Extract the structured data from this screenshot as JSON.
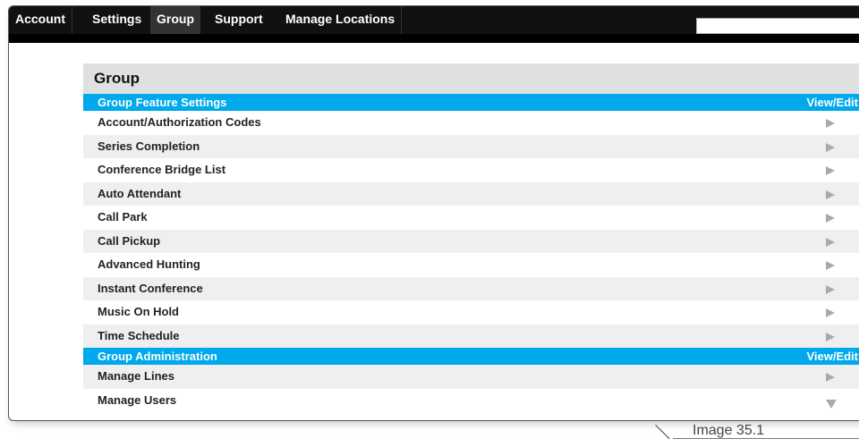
{
  "nav": {
    "items": [
      {
        "label": "Account"
      },
      {
        "label": "Settings"
      },
      {
        "label": "Group"
      },
      {
        "label": "Support"
      },
      {
        "label": "Manage Locations"
      }
    ],
    "active": "Group",
    "search_value": ""
  },
  "page": {
    "title": "Group"
  },
  "sections": [
    {
      "title": "Group Feature Settings",
      "action": "View/Edit",
      "items": [
        {
          "label": "Account/Authorization Codes"
        },
        {
          "label": "Series Completion"
        },
        {
          "label": "Conference Bridge List"
        },
        {
          "label": "Auto Attendant"
        },
        {
          "label": "Call Park"
        },
        {
          "label": "Call Pickup"
        },
        {
          "label": "Advanced Hunting"
        },
        {
          "label": "Instant Conference"
        },
        {
          "label": "Music On Hold"
        },
        {
          "label": "Time Schedule"
        }
      ]
    },
    {
      "title": "Group Administration",
      "action": "View/Edit",
      "items": [
        {
          "label": "Manage Lines"
        },
        {
          "label": "Manage Users"
        }
      ]
    }
  ],
  "caption": "Image 35.1",
  "colors": {
    "section_header": "#00a9ec",
    "nav_bg": "#111111",
    "active_tab": "#333333",
    "arrow": "#aaaaaa"
  }
}
